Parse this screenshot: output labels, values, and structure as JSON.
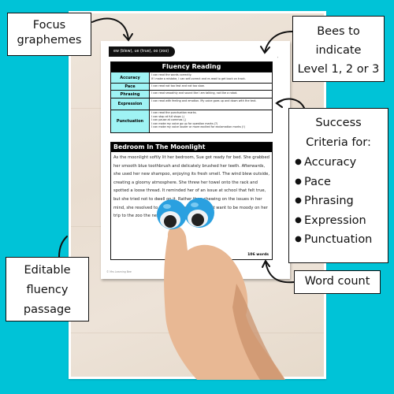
{
  "worksheet": {
    "focus_graphemes": "ew (blew), ue (true), oo (zoo)",
    "bees_glyph": "༌༌",
    "fluency": {
      "title": "Fluency Reading",
      "rows": [
        {
          "label": "Accuracy",
          "text": "I can read the words correctly.\nIf I make a mistake, I can self-correct and re-read to get back on track."
        },
        {
          "label": "Pace",
          "text": "I can read not too fast and not too slow."
        },
        {
          "label": "Phrasing",
          "text": "I can read smoothly and sound like I am talking, not like a robot."
        },
        {
          "label": "Expression",
          "text": "I can read with feeling and emotion. My voice goes up and down with the text."
        },
        {
          "label": "Punctuation",
          "text": "I can read the punctuation marks.\nI can stop at full stops (.)\nI can pause at commas (,)\nI can make my voice go up for question marks (?)\nI can make my voice louder or more excited for exclamation marks (!)"
        }
      ]
    },
    "passage": {
      "title": "Bedroom In The Moonlight",
      "text": "As the moonlight softly lit her bedroom, Sue got ready for bed. She grabbed her smooth blue toothbrush and delicately brushed her teeth. Afterwards, she used her new shampoo, enjoying its fresh smell. The wind blew outside, creating a gloomy atmosphere. She threw her towel onto the rack and spotted a loose thread. It reminded her of an issue at school that felt true, but she tried not to dwell on it. Rather than chewing on the issues in her mind, she resolved to drift off to sleep. She didn't want to be moody on her trip to the zoo the next day.",
      "word_count": "106 words"
    },
    "copyright": "© Mrs Learning Bee"
  },
  "callouts": {
    "focus": [
      "Focus",
      "graphemes"
    ],
    "bees": [
      "Bees to",
      "indicate",
      "Level 1, 2 or 3"
    ],
    "success": {
      "heading": [
        "Success",
        "Criteria for:"
      ],
      "items": [
        "Accuracy",
        "Pace",
        "Phrasing",
        "Expression",
        "Punctuation"
      ]
    },
    "word_count": "Word count",
    "editable": [
      "Editable",
      "fluency",
      "passage"
    ]
  },
  "colors": {
    "background": "#00c3d7",
    "criteria_cell": "#9ff3f4",
    "header_black": "#000000",
    "eyeball_blue": "#2aa0e0"
  }
}
